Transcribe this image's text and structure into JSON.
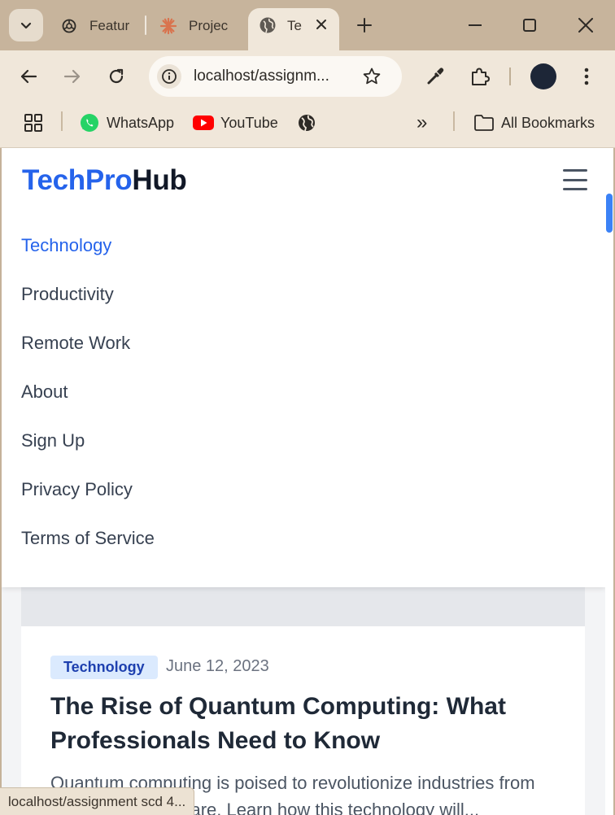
{
  "browser": {
    "tabs": [
      {
        "label": "Featur",
        "icon": "chatgpt-icon"
      },
      {
        "label": "Projec",
        "icon": "claude-icon"
      },
      {
        "label": "Te",
        "icon": "globe-icon",
        "active": true
      }
    ],
    "address_url": "localhost/assignm...",
    "bookmarks": [
      {
        "label": "WhatsApp",
        "icon": "whatsapp-icon"
      },
      {
        "label": "YouTube",
        "icon": "youtube-icon"
      },
      {
        "label": "",
        "icon": "globe-icon"
      }
    ],
    "overflow_glyph": "»",
    "all_bookmarks_label": "All Bookmarks",
    "status_url": "localhost/assignment scd 4..."
  },
  "site": {
    "logo_part1": "TechPro",
    "logo_part2": "Hub",
    "nav": [
      {
        "label": "Technology",
        "active": true
      },
      {
        "label": "Productivity"
      },
      {
        "label": "Remote Work"
      },
      {
        "label": "About"
      },
      {
        "label": "Sign Up"
      },
      {
        "label": "Privacy Policy"
      },
      {
        "label": "Terms of Service"
      }
    ]
  },
  "post": {
    "category": "Technology",
    "date": "June 12, 2023",
    "title": "The Rise of Quantum Computing: What Professionals Need to Know",
    "excerpt": "Quantum computing is poised to revolutionize industries from finance to healthcare. Learn how this technology will..."
  },
  "colors": {
    "accent": "#2563eb",
    "badge_bg": "#dbeafe",
    "chrome_bg": "#c7b49c",
    "toolbar_bg": "#f0e7da"
  }
}
